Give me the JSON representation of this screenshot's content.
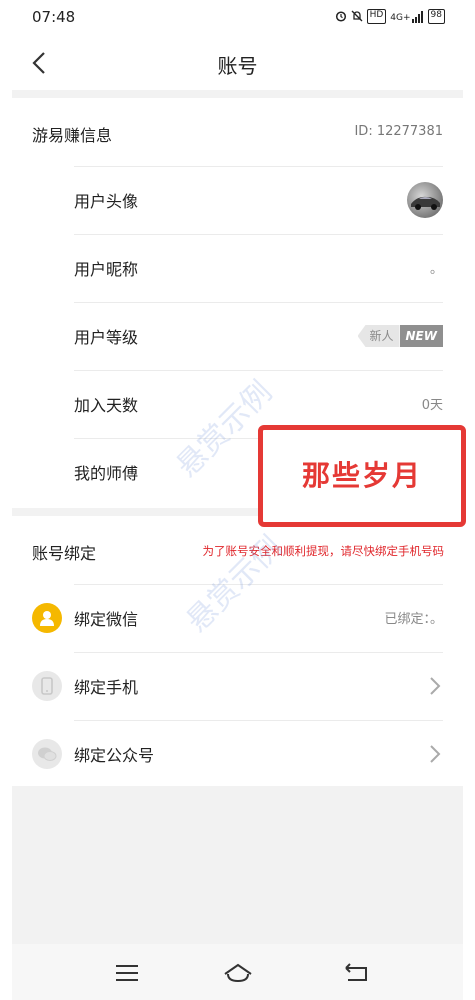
{
  "status_bar": {
    "time": "07:48",
    "icons": [
      "alarm-icon",
      "mute-icon",
      "hd-icon",
      "signal-4g-icon",
      "battery-icon"
    ],
    "hd": "HD",
    "network": "4G+",
    "battery": "98"
  },
  "nav": {
    "title": "账号"
  },
  "account_info": {
    "header": "游易赚信息",
    "id_text": "ID: 12277381",
    "items": [
      {
        "label": "用户头像",
        "value": ""
      },
      {
        "label": "用户昵称",
        "value": "。"
      },
      {
        "label": "用户等级",
        "badge_left": "新人",
        "badge_right": "NEW"
      },
      {
        "label": "加入天数",
        "value": "0天"
      },
      {
        "label": "我的师傅",
        "value": ""
      }
    ]
  },
  "overlay": {
    "text": "那些岁月",
    "color": "#e53935"
  },
  "binding": {
    "header": "账号绑定",
    "warning": "为了账号安全和顺利提现，请尽快绑定手机号码",
    "items": [
      {
        "label": "绑定微信",
        "value": "已绑定：。",
        "icon": "wechat-icon"
      },
      {
        "label": "绑定手机",
        "icon": "phone-icon"
      },
      {
        "label": "绑定公众号",
        "icon": "official-account-icon"
      }
    ]
  },
  "watermark": {
    "text": "悬赏示例"
  },
  "colors": {
    "accent_red": "#e53935",
    "warning_red": "#e0262b",
    "wechat_yellow": "#f5b800",
    "background": "#f2f2f2"
  }
}
